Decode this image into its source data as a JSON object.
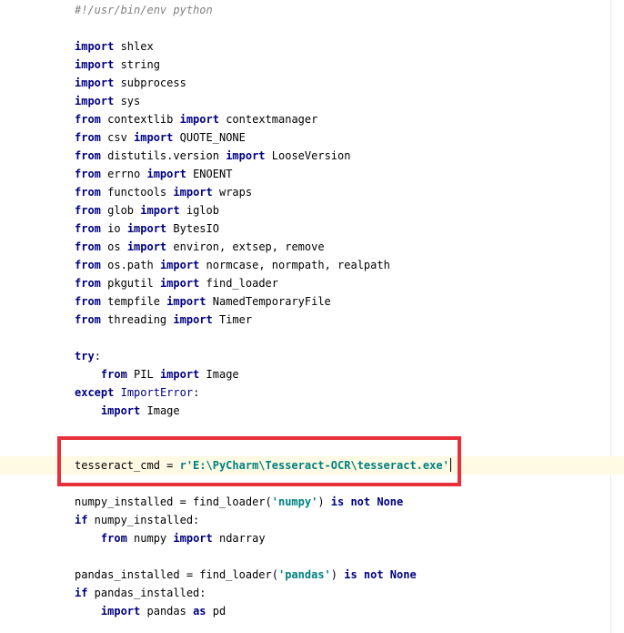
{
  "editor": {
    "lines": [
      [
        {
          "t": "#!/usr/bin/env python",
          "c": "cmt"
        }
      ],
      [],
      [
        {
          "t": "import",
          "c": "kw"
        },
        {
          "t": " shlex",
          "c": ""
        }
      ],
      [
        {
          "t": "import",
          "c": "kw"
        },
        {
          "t": " string",
          "c": ""
        }
      ],
      [
        {
          "t": "import",
          "c": "kw"
        },
        {
          "t": " subprocess",
          "c": ""
        }
      ],
      [
        {
          "t": "import",
          "c": "kw"
        },
        {
          "t": " sys",
          "c": ""
        }
      ],
      [
        {
          "t": "from",
          "c": "kw"
        },
        {
          "t": " contextlib ",
          "c": ""
        },
        {
          "t": "import",
          "c": "kw"
        },
        {
          "t": " contextmanager",
          "c": ""
        }
      ],
      [
        {
          "t": "from",
          "c": "kw"
        },
        {
          "t": " csv ",
          "c": ""
        },
        {
          "t": "import",
          "c": "kw"
        },
        {
          "t": " QUOTE_NONE",
          "c": ""
        }
      ],
      [
        {
          "t": "from",
          "c": "kw"
        },
        {
          "t": " distutils.version ",
          "c": ""
        },
        {
          "t": "import",
          "c": "kw"
        },
        {
          "t": " LooseVersion",
          "c": ""
        }
      ],
      [
        {
          "t": "from",
          "c": "kw"
        },
        {
          "t": " errno ",
          "c": ""
        },
        {
          "t": "import",
          "c": "kw"
        },
        {
          "t": " ENOENT",
          "c": ""
        }
      ],
      [
        {
          "t": "from",
          "c": "kw"
        },
        {
          "t": " functools ",
          "c": ""
        },
        {
          "t": "import",
          "c": "kw"
        },
        {
          "t": " wraps",
          "c": ""
        }
      ],
      [
        {
          "t": "from",
          "c": "kw"
        },
        {
          "t": " glob ",
          "c": ""
        },
        {
          "t": "import",
          "c": "kw"
        },
        {
          "t": " iglob",
          "c": ""
        }
      ],
      [
        {
          "t": "from",
          "c": "kw"
        },
        {
          "t": " io ",
          "c": ""
        },
        {
          "t": "import",
          "c": "kw"
        },
        {
          "t": " BytesIO",
          "c": ""
        }
      ],
      [
        {
          "t": "from",
          "c": "kw"
        },
        {
          "t": " os ",
          "c": ""
        },
        {
          "t": "import",
          "c": "kw"
        },
        {
          "t": " environ, extsep, remove",
          "c": ""
        }
      ],
      [
        {
          "t": "from",
          "c": "kw"
        },
        {
          "t": " os.path ",
          "c": ""
        },
        {
          "t": "import",
          "c": "kw"
        },
        {
          "t": " normcase, normpath, realpath",
          "c": ""
        }
      ],
      [
        {
          "t": "from",
          "c": "kw"
        },
        {
          "t": " pkgutil ",
          "c": ""
        },
        {
          "t": "import",
          "c": "kw"
        },
        {
          "t": " find_loader",
          "c": ""
        }
      ],
      [
        {
          "t": "from",
          "c": "kw"
        },
        {
          "t": " tempfile ",
          "c": ""
        },
        {
          "t": "import",
          "c": "kw"
        },
        {
          "t": " NamedTemporaryFile",
          "c": ""
        }
      ],
      [
        {
          "t": "from",
          "c": "kw"
        },
        {
          "t": " threading ",
          "c": ""
        },
        {
          "t": "import",
          "c": "kw"
        },
        {
          "t": " Timer",
          "c": ""
        }
      ],
      [],
      [
        {
          "t": "try",
          "c": "kw"
        },
        {
          "t": ":",
          "c": ""
        }
      ],
      [
        {
          "t": "    ",
          "c": ""
        },
        {
          "t": "from",
          "c": "kw"
        },
        {
          "t": " PIL ",
          "c": ""
        },
        {
          "t": "import",
          "c": "kw"
        },
        {
          "t": " Image",
          "c": ""
        }
      ],
      [
        {
          "t": "except",
          "c": "kw"
        },
        {
          "t": " ",
          "c": ""
        },
        {
          "t": "ImportError",
          "c": "cls"
        },
        {
          "t": ":",
          "c": ""
        }
      ],
      [
        {
          "t": "    ",
          "c": ""
        },
        {
          "t": "import",
          "c": "kw"
        },
        {
          "t": " Image",
          "c": ""
        }
      ],
      [],
      [],
      [
        {
          "t": "tesseract_cmd = ",
          "c": ""
        },
        {
          "t": "r'E:\\PyCharm\\Tesseract-OCR\\tesseract.exe'",
          "c": "str"
        }
      ],
      [],
      [
        {
          "t": "numpy_installed = find_loader(",
          "c": ""
        },
        {
          "t": "'numpy'",
          "c": "str"
        },
        {
          "t": ") ",
          "c": ""
        },
        {
          "t": "is not None",
          "c": "kw"
        }
      ],
      [
        {
          "t": "if",
          "c": "kw"
        },
        {
          "t": " numpy_installed:",
          "c": ""
        }
      ],
      [
        {
          "t": "    ",
          "c": ""
        },
        {
          "t": "from",
          "c": "kw"
        },
        {
          "t": " numpy ",
          "c": ""
        },
        {
          "t": "import",
          "c": "kw"
        },
        {
          "t": " ndarray",
          "c": ""
        }
      ],
      [],
      [
        {
          "t": "pandas_installed = find_loader(",
          "c": ""
        },
        {
          "t": "'pandas'",
          "c": "str"
        },
        {
          "t": ") ",
          "c": ""
        },
        {
          "t": "is not None",
          "c": "kw"
        }
      ],
      [
        {
          "t": "if",
          "c": "kw"
        },
        {
          "t": " pandas_installed:",
          "c": ""
        }
      ],
      [
        {
          "t": "    ",
          "c": ""
        },
        {
          "t": "import",
          "c": "kw"
        },
        {
          "t": " pandas ",
          "c": ""
        },
        {
          "t": "as",
          "c": "kw"
        },
        {
          "t": " pd",
          "c": ""
        }
      ]
    ],
    "current_line": 25
  },
  "colors": {
    "keyword": "#000080",
    "string": "#008080",
    "comment": "#808080",
    "current_line_bg": "#fffae3",
    "highlight_box": "#e8303b"
  }
}
